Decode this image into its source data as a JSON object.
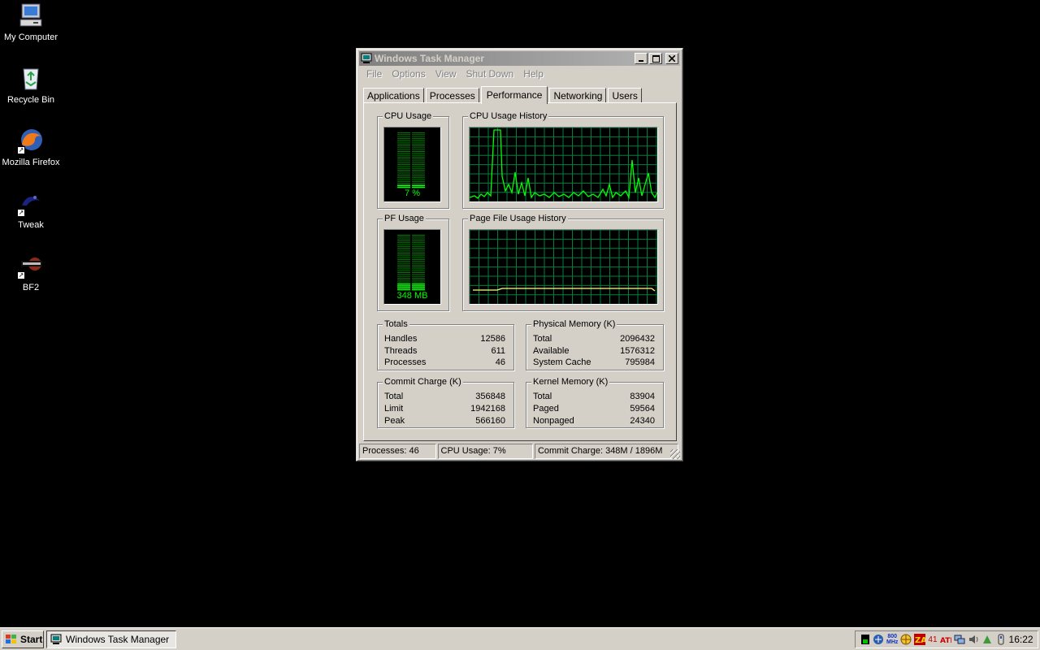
{
  "desktop": {
    "icons": [
      {
        "label": "My Computer",
        "icon": "my-computer-icon"
      },
      {
        "label": "Recycle Bin",
        "icon": "recycle-bin-icon"
      },
      {
        "label": "Mozilla Firefox",
        "icon": "firefox-icon"
      },
      {
        "label": "Tweak",
        "icon": "tweak-icon"
      },
      {
        "label": "BF2",
        "icon": "bf2-icon"
      }
    ]
  },
  "window": {
    "title": "Windows Task Manager",
    "menu": [
      "File",
      "Options",
      "View",
      "Shut Down",
      "Help"
    ],
    "tabs": [
      {
        "label": "Applications",
        "active": false
      },
      {
        "label": "Processes",
        "active": false
      },
      {
        "label": "Performance",
        "active": true
      },
      {
        "label": "Networking",
        "active": false
      },
      {
        "label": "Users",
        "active": false
      }
    ],
    "cpu_usage": {
      "title": "CPU Usage",
      "value_text": "7 %",
      "percent": 7
    },
    "cpu_history": {
      "title": "CPU Usage History"
    },
    "pf_usage": {
      "title": "PF Usage",
      "value_text": "348 MB"
    },
    "pf_history": {
      "title": "Page File Usage History"
    },
    "totals": {
      "title": "Totals",
      "rows": [
        {
          "label": "Handles",
          "value": "12586"
        },
        {
          "label": "Threads",
          "value": "611"
        },
        {
          "label": "Processes",
          "value": "46"
        }
      ]
    },
    "physical_memory": {
      "title": "Physical Memory (K)",
      "rows": [
        {
          "label": "Total",
          "value": "2096432"
        },
        {
          "label": "Available",
          "value": "1576312"
        },
        {
          "label": "System Cache",
          "value": "795984"
        }
      ]
    },
    "commit_charge": {
      "title": "Commit Charge (K)",
      "rows": [
        {
          "label": "Total",
          "value": "356848"
        },
        {
          "label": "Limit",
          "value": "1942168"
        },
        {
          "label": "Peak",
          "value": "566160"
        }
      ]
    },
    "kernel_memory": {
      "title": "Kernel Memory (K)",
      "rows": [
        {
          "label": "Total",
          "value": "83904"
        },
        {
          "label": "Paged",
          "value": "59564"
        },
        {
          "label": "Nonpaged",
          "value": "24340"
        }
      ]
    },
    "status": {
      "processes": "Processes: 46",
      "cpu": "CPU Usage: 7%",
      "commit": "Commit Charge: 348M / 1896M"
    }
  },
  "taskbar": {
    "start_label": "Start",
    "task_label": "Windows Task Manager",
    "tray_cpu_speed": "800 MHz",
    "tray_temp": "41",
    "clock": "16:22"
  },
  "colors": {
    "graph_green": "#00ff00",
    "grid_green": "#008040",
    "pf_yellow": "#ffff80"
  }
}
